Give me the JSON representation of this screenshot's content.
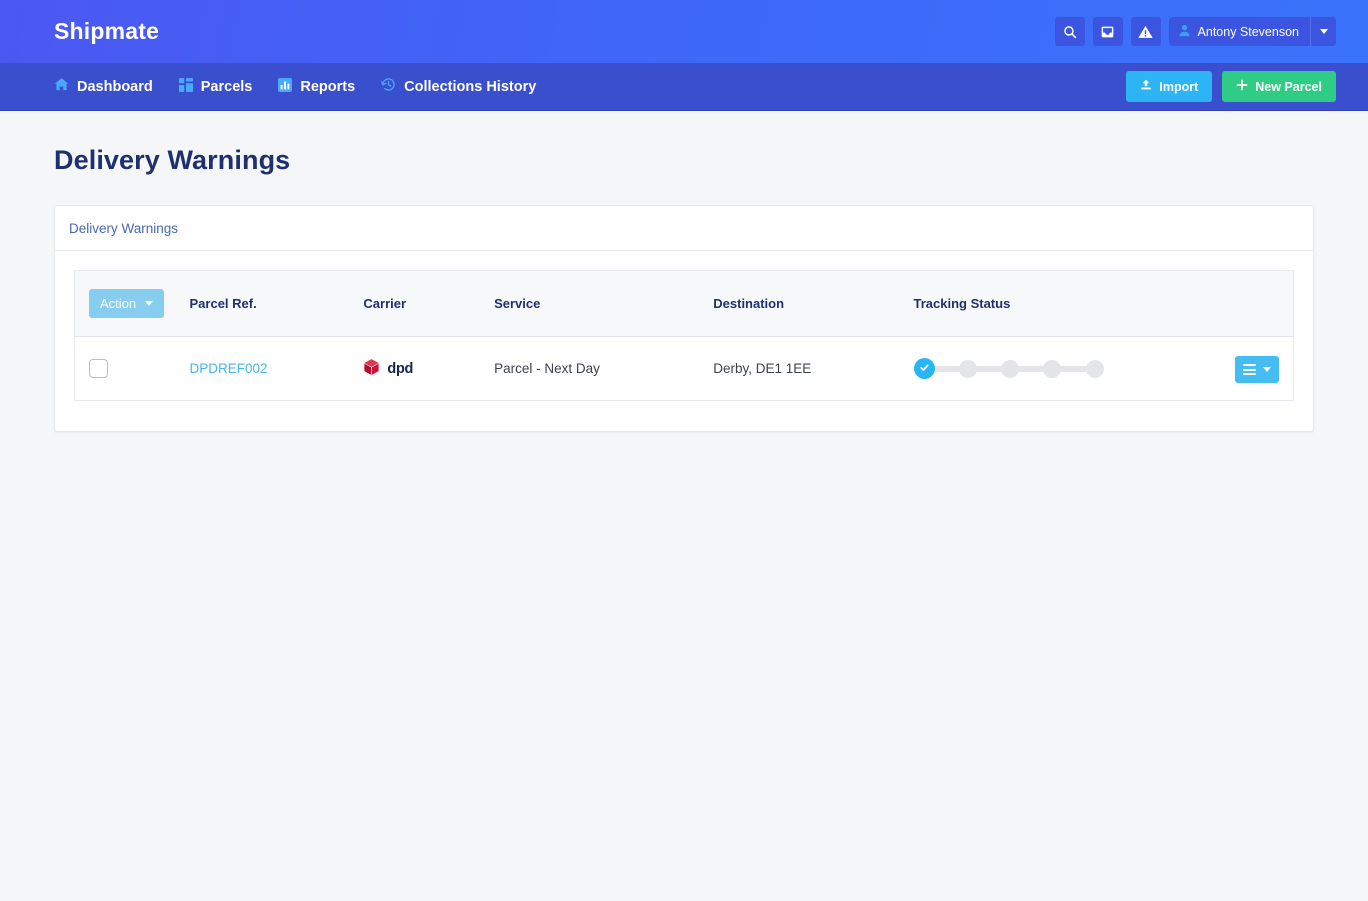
{
  "header": {
    "brand": "Shipmate",
    "icons": [
      {
        "name": "search-icon",
        "label": "Search"
      },
      {
        "name": "inbox-icon",
        "label": "Inbox"
      },
      {
        "name": "warning-icon",
        "label": "Warnings"
      }
    ],
    "user": {
      "name": "Antony Stevenson"
    }
  },
  "nav": {
    "items": [
      {
        "label": "Dashboard",
        "icon": "home-icon"
      },
      {
        "label": "Parcels",
        "icon": "grid-icon"
      },
      {
        "label": "Reports",
        "icon": "bar-chart-icon"
      },
      {
        "label": "Collections History",
        "icon": "history-icon"
      }
    ],
    "import_label": "Import",
    "new_parcel_label": "New Parcel"
  },
  "page": {
    "title": "Delivery Warnings",
    "card_title": "Delivery Warnings"
  },
  "table": {
    "action_label": "Action",
    "columns": [
      "",
      "Parcel Ref.",
      "Carrier",
      "Service",
      "Destination",
      "Tracking Status",
      ""
    ],
    "rows": [
      {
        "selected": false,
        "parcel_ref": "DPDREF002",
        "carrier": "dpd",
        "service": "Parcel - Next Day",
        "destination": "Derby, DE1 1EE",
        "tracking": {
          "total_steps": 5,
          "completed_steps": 1
        }
      }
    ]
  },
  "colors": {
    "topbar_start": "#4b58f2",
    "topbar_end": "#3a73fb",
    "navbar": "#3a4fce",
    "import_btn": "#2cb4f5",
    "new_parcel_btn": "#2ecc85",
    "title_navy": "#1f3070",
    "card_title": "#4a68ad",
    "link_blue": "#4ab3e8",
    "action_btn": "#86cdf0",
    "row_menu_btn": "#45bdf2",
    "step_done": "#29b6f2",
    "step_pending": "#e3e5e8",
    "dpd_red": "#c8102e",
    "page_bg": "#f4f6f8"
  }
}
